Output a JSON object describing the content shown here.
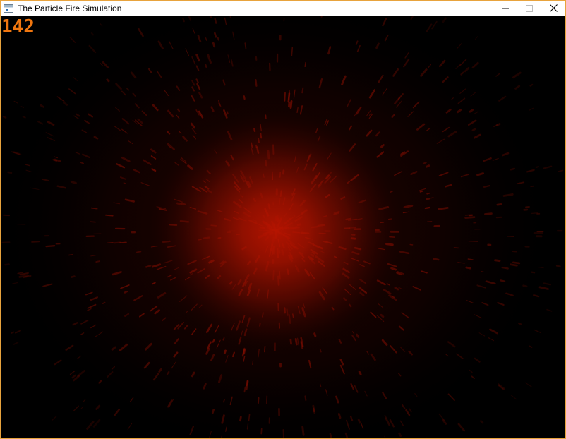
{
  "window": {
    "title": "The Particle Fire Simulation",
    "border_color": "#e8a33d"
  },
  "titlebar": {
    "app_icon": "window-app-icon",
    "minimize_icon": "minimize-icon",
    "maximize_icon": "maximize-icon",
    "close_icon": "close-icon"
  },
  "simulation": {
    "fps_counter": "142",
    "fps_color": "#f0760f",
    "background": "#000000",
    "particle_color": "#b81400"
  }
}
